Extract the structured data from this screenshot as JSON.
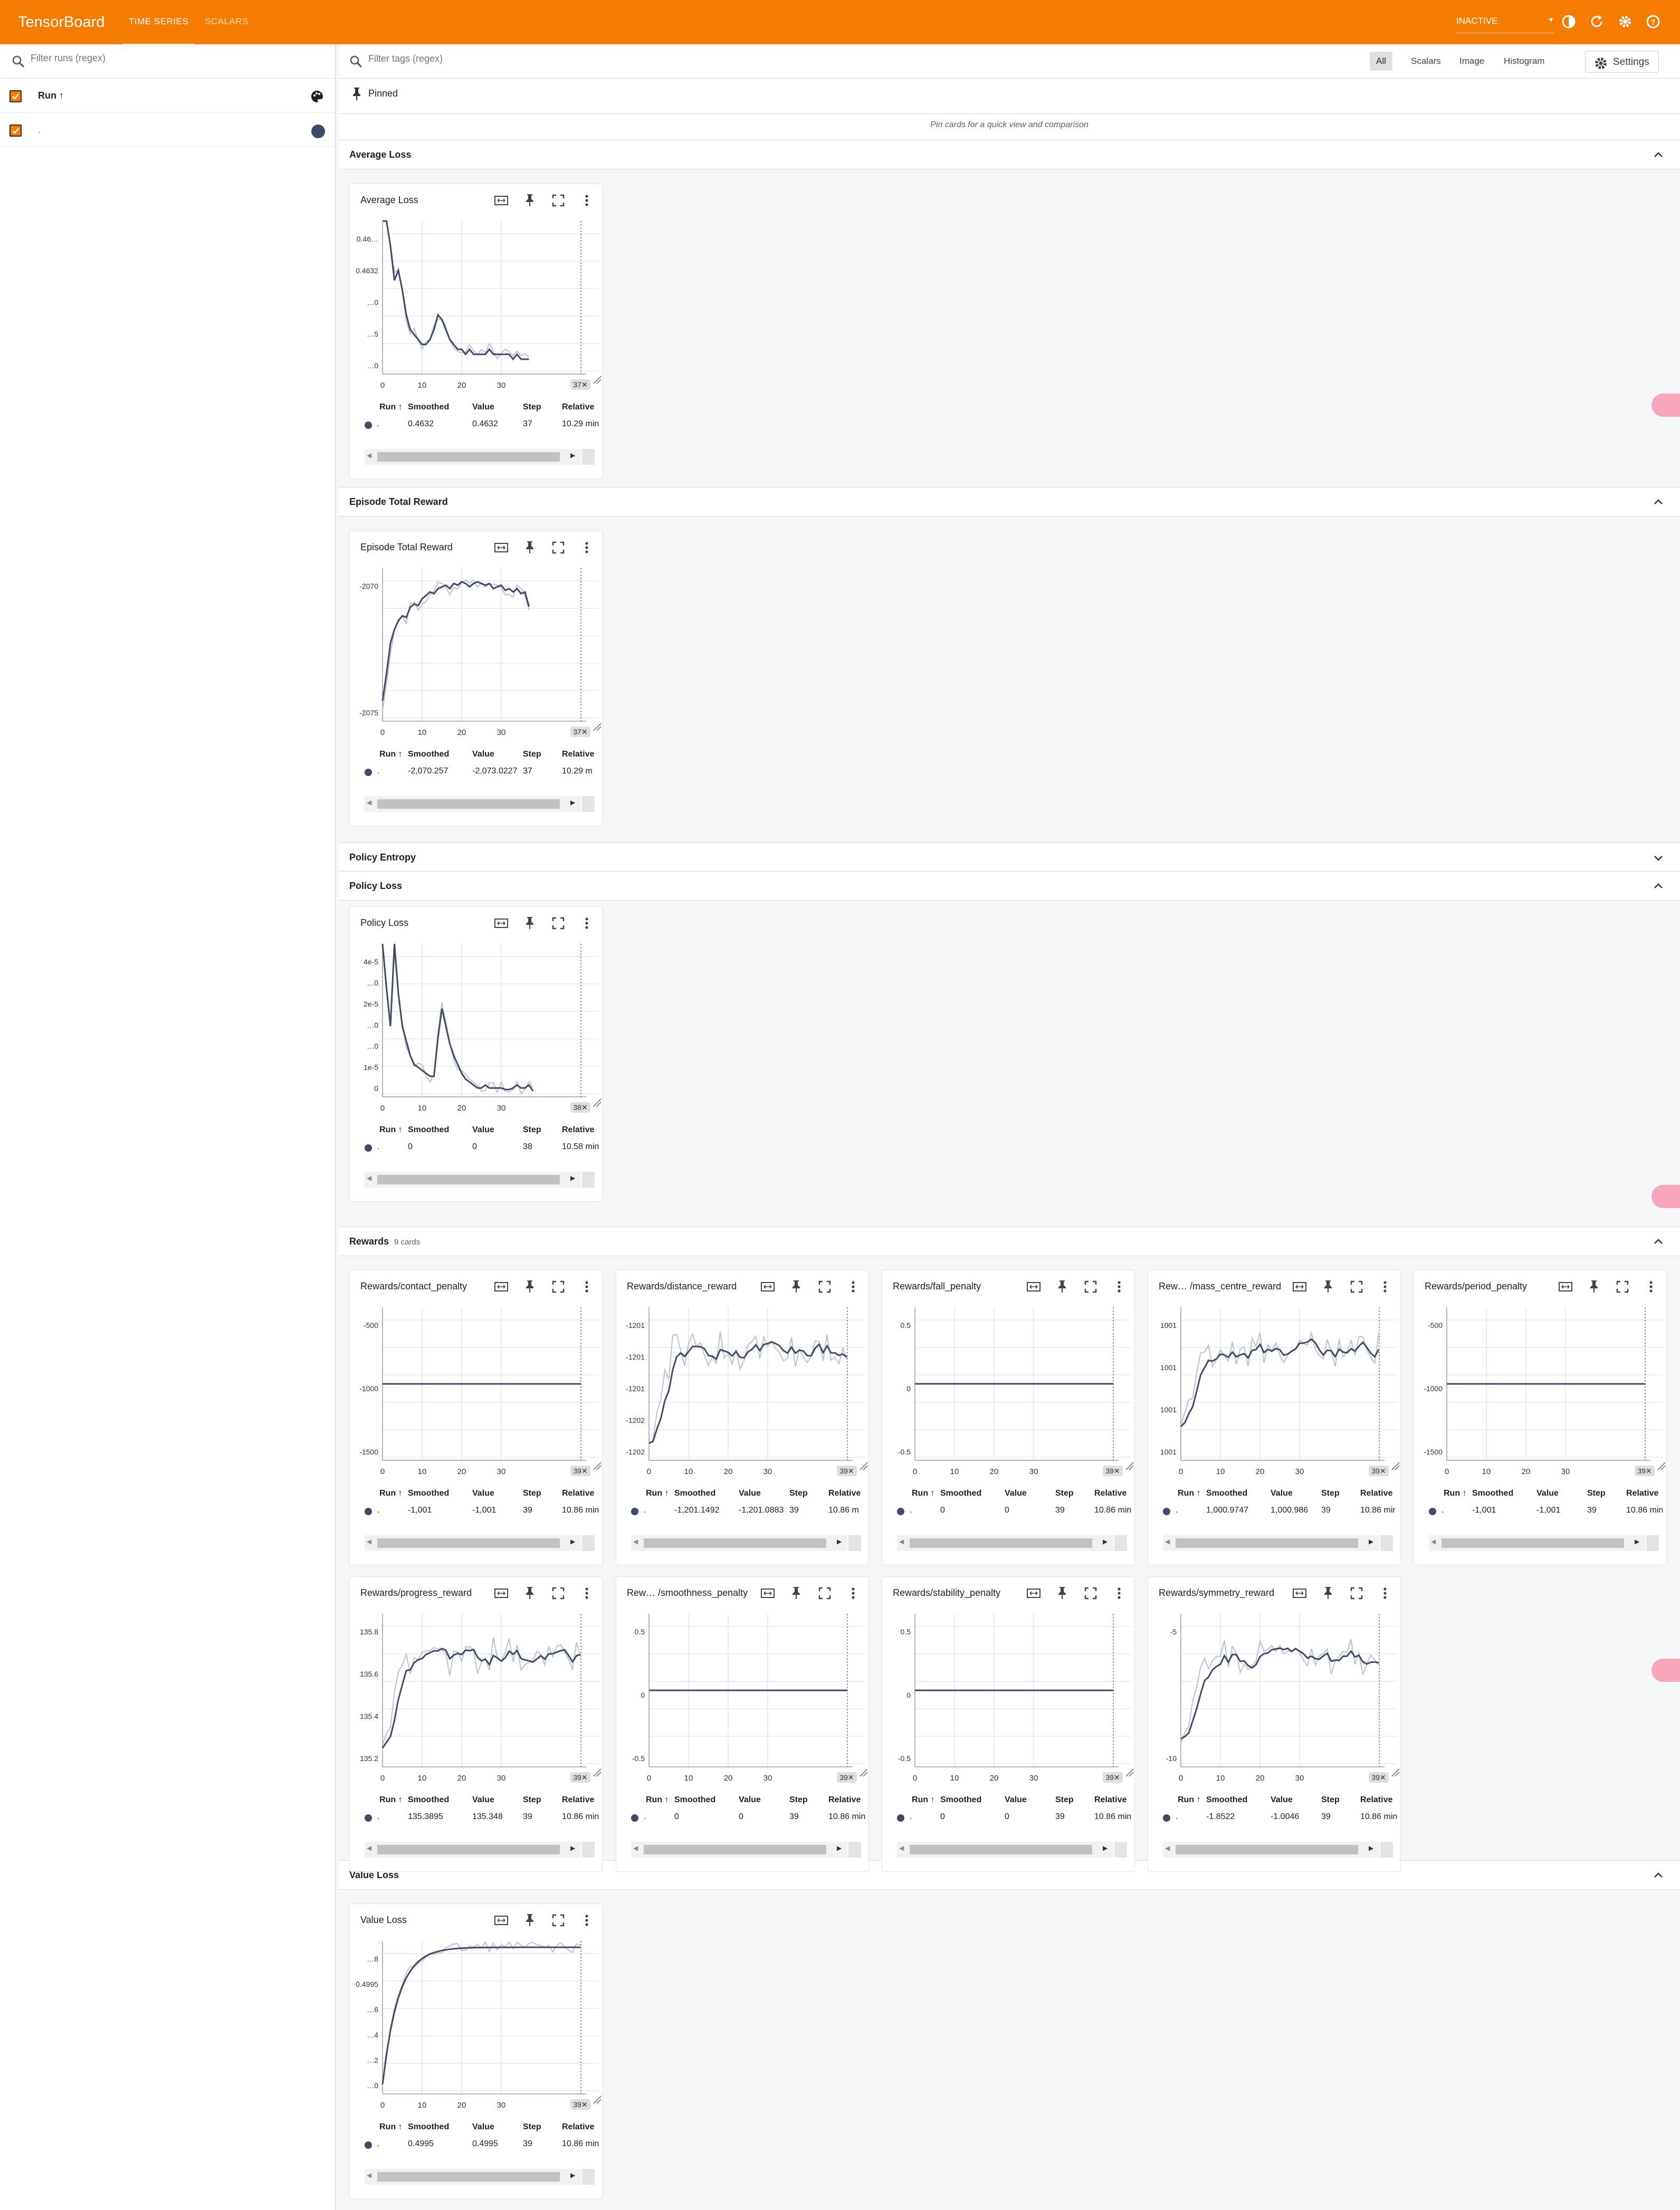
{
  "app": {
    "brand": "TensorBoard",
    "tabs": [
      "TIME SERIES",
      "SCALARS"
    ],
    "status": "INACTIVE",
    "accent": "#f57c00"
  },
  "runs_panel": {
    "filter_placeholder": "Filter runs (regex)",
    "header_label": "Run ↑",
    "runs": [
      {
        "label": ".",
        "color": "#3f4b66"
      }
    ]
  },
  "tag_filter": {
    "placeholder": "Filter tags (regex)",
    "types": [
      "All",
      "Scalars",
      "Image",
      "Histogram"
    ],
    "settings_label": "Settings"
  },
  "pinned": {
    "title": "Pinned",
    "hint": "Pin cards for a quick view and comparison"
  },
  "table_headers": [
    "Run ↑",
    "Smoothed",
    "Value",
    "Step",
    "Relative"
  ],
  "groups": [
    {
      "title": "Average Loss",
      "count_label": "",
      "expanded": true
    },
    {
      "title": "Episode Total Reward",
      "count_label": "",
      "expanded": true
    },
    {
      "title": "Policy Entropy",
      "count_label": "",
      "expanded": false
    },
    {
      "title": "Policy Loss",
      "count_label": "",
      "expanded": true
    },
    {
      "title": "Rewards",
      "count_label": "9 cards",
      "expanded": true
    },
    {
      "title": "Value Loss",
      "count_label": "",
      "expanded": true
    }
  ],
  "cards": [
    {
      "title": "Average Loss",
      "last_step_label": "37",
      "row": {
        "run": ".",
        "smoothed": "0.4632",
        "value": "0.4632",
        "step": "37",
        "relative": "10.29 min"
      },
      "chart_data": {
        "type": "line",
        "x": [
          0,
          1,
          2,
          3,
          4,
          5,
          6,
          7,
          8,
          9,
          10,
          11,
          12,
          13,
          14,
          15,
          16,
          17,
          18,
          19,
          20,
          21,
          22,
          23,
          24,
          25,
          26,
          27,
          28,
          29,
          30,
          31,
          32,
          33,
          34,
          35,
          36,
          37
        ],
        "series": [
          {
            "values": [
              0.4675,
              0.4668,
              0.4655,
              0.4648,
              0.465,
              0.4646,
              0.4641,
              0.4638,
              0.4637,
              0.4636,
              0.4635,
              0.4635,
              0.4636,
              0.4638,
              0.4641,
              0.464,
              0.4638,
              0.4636,
              0.4635,
              0.4634,
              0.4634,
              0.4633,
              0.4634,
              0.4633,
              0.4633,
              0.4633,
              0.4633,
              0.4634,
              0.4633,
              0.4633,
              0.4633,
              0.4633,
              0.4633,
              0.4632,
              0.4633,
              0.4632,
              0.4632,
              0.4632
            ]
          }
        ],
        "yticks": [
          "0.463",
          "0.4632",
          "0.465",
          "0.4633",
          "0.464"
        ],
        "ytick_labels": [
          "0.46…",
          "0.4632",
          "…0",
          "…5",
          "…0"
        ],
        "xticks": [
          0,
          10,
          20,
          30
        ],
        "ylim": [
          0.4629,
          0.466
        ]
      }
    },
    {
      "title": "Episode Total Reward",
      "last_step_label": "37",
      "row": {
        "run": ".",
        "smoothed": "-2,070.257",
        "value": "-2,073.0227",
        "step": "37",
        "relative": "10.29 m"
      },
      "chart_data": {
        "type": "line",
        "x": [
          0,
          1,
          2,
          3,
          4,
          5,
          6,
          7,
          8,
          9,
          10,
          11,
          12,
          13,
          14,
          15,
          16,
          17,
          18,
          19,
          20,
          21,
          22,
          23,
          24,
          25,
          26,
          27,
          28,
          29,
          30,
          31,
          32,
          33,
          34,
          35,
          36,
          37
        ],
        "series": [
          {
            "values": [
              -2075.8,
              -2074.2,
              -2072.4,
              -2071.6,
              -2071.1,
              -2070.8,
              -2070.9,
              -2070.3,
              -2070.1,
              -2070.2,
              -2069.8,
              -2069.6,
              -2069.4,
              -2069.5,
              -2069.2,
              -2069.1,
              -2069.0,
              -2069.2,
              -2068.9,
              -2069.0,
              -2068.8,
              -2068.9,
              -2069.1,
              -2068.9,
              -2068.8,
              -2068.9,
              -2069.0,
              -2068.9,
              -2069.2,
              -2069.1,
              -2069.0,
              -2069.3,
              -2069.2,
              -2069.4,
              -2069.2,
              -2069.5,
              -2069.4,
              -2070.26
            ]
          }
        ],
        "yticks": [
          -2070,
          -2075
        ],
        "xticks": [
          0,
          10,
          20,
          30
        ],
        "ylim": [
          -2077,
          -2068
        ]
      }
    },
    {
      "title": "Policy Loss",
      "last_step_label": "38",
      "row": {
        "run": ".",
        "smoothed": "0",
        "value": "0",
        "step": "38",
        "relative": "10.58 min"
      },
      "chart_data": {
        "type": "line",
        "x": [
          0,
          1,
          2,
          3,
          4,
          5,
          6,
          7,
          8,
          9,
          10,
          11,
          12,
          13,
          14,
          15,
          16,
          17,
          18,
          19,
          20,
          21,
          22,
          23,
          24,
          25,
          26,
          27,
          28,
          29,
          30,
          31,
          32,
          33,
          34,
          35,
          36,
          37,
          38
        ],
        "series": [
          {
            "values": [
              5e-05,
              3.5e-05,
              2.2e-05,
              5e-05,
              3.3e-05,
              2.2e-05,
              1.7e-05,
              1.2e-05,
              9e-06,
              8e-06,
              7e-06,
              6e-06,
              5e-06,
              5e-06,
              1.8e-05,
              2.8e-05,
              2.2e-05,
              1.6e-05,
              1.2e-05,
              9e-06,
              6e-06,
              4e-06,
              3e-06,
              2e-06,
              1e-06,
              1e-06,
              2e-06,
              1e-06,
              1e-06,
              1e-06,
              1e-06,
              5e-07,
              5e-07,
              1e-06,
              2e-06,
              1e-06,
              1e-06,
              2e-06,
              0
            ]
          }
        ],
        "ytick_labels": [
          "4e-5",
          "…0",
          "2e-5",
          "…0",
          "…0",
          "1e-5",
          "0"
        ],
        "xticks": [
          0,
          10,
          20,
          30
        ],
        "ylim": [
          -2e-06,
          5e-05
        ]
      }
    },
    {
      "title": "Rewards/contact_penalty",
      "last_step_label": "39",
      "row": {
        "run": ".",
        "smoothed": "-1,001",
        "value": "-1,001",
        "step": "39",
        "relative": "10.86 min"
      },
      "chart_data": {
        "type": "line",
        "flat": -1001,
        "yticks": [
          -500,
          -1000,
          -1500
        ],
        "xticks": [
          0,
          10,
          20,
          30
        ],
        "ylim": [
          -2000,
          0
        ]
      }
    },
    {
      "title": "Rewards/distance_reward",
      "last_step_label": "39",
      "row": {
        "run": ".",
        "smoothed": "-1,201.1492",
        "value": "-1,201.0883",
        "step": "39",
        "relative": "10.86 m"
      },
      "chart_data": {
        "type": "line",
        "ytick_labels": [
          "-1201",
          "-1201",
          "-1201",
          "-1202",
          "-1202"
        ],
        "xticks": [
          0,
          10,
          20,
          30
        ],
        "noisy": true
      }
    },
    {
      "title": "Rewards/fall_penalty",
      "last_step_label": "39",
      "row": {
        "run": ".",
        "smoothed": "0",
        "value": "0",
        "step": "39",
        "relative": "10.86 min"
      },
      "chart_data": {
        "type": "line",
        "flat": 0,
        "yticks": [
          0.5,
          0,
          -0.5
        ],
        "xticks": [
          0,
          10,
          20,
          30
        ],
        "ylim": [
          -1,
          1
        ]
      }
    },
    {
      "title": "Rew… /mass_centre_reward",
      "last_step_label": "39",
      "row": {
        "run": ".",
        "smoothed": "1,000.9747",
        "value": "1,000.986",
        "step": "39",
        "relative": "10.86 mir"
      },
      "chart_data": {
        "type": "line",
        "ytick_labels": [
          "1001",
          "1001",
          "1001",
          "1001"
        ],
        "xticks": [
          0,
          10,
          20,
          30
        ],
        "noisy": true
      }
    },
    {
      "title": "Rewards/period_penalty",
      "last_step_label": "39",
      "row": {
        "run": ".",
        "smoothed": "-1,001",
        "value": "-1,001",
        "step": "39",
        "relative": "10.86 min"
      },
      "chart_data": {
        "type": "line",
        "flat": -1001,
        "yticks": [
          -500,
          -1000,
          -1500
        ],
        "xticks": [
          0,
          10,
          20,
          30
        ],
        "ylim": [
          -2000,
          0
        ]
      }
    },
    {
      "title": "Rewards/progress_reward",
      "last_step_label": "39",
      "row": {
        "run": ".",
        "smoothed": "135.3895",
        "value": "135.348",
        "step": "39",
        "relative": "10.86 min"
      },
      "chart_data": {
        "type": "line",
        "yticks": [
          "135.8",
          "135.6",
          "135.4",
          "135.2"
        ],
        "xticks": [
          0,
          10,
          20,
          30
        ],
        "noisy": true
      }
    },
    {
      "title": "Rew… /smoothness_penalty",
      "last_step_label": "39",
      "row": {
        "run": ".",
        "smoothed": "0",
        "value": "0",
        "step": "39",
        "relative": "10.86 min"
      },
      "chart_data": {
        "type": "line",
        "flat": 0,
        "yticks": [
          0.5,
          0,
          -0.5
        ],
        "xticks": [
          0,
          10,
          20,
          30
        ],
        "ylim": [
          -1,
          1
        ]
      }
    },
    {
      "title": "Rewards/stability_penalty",
      "last_step_label": "39",
      "row": {
        "run": ".",
        "smoothed": "0",
        "value": "0",
        "step": "39",
        "relative": "10.86 min"
      },
      "chart_data": {
        "type": "line",
        "flat": 0,
        "yticks": [
          0.5,
          0,
          -0.5
        ],
        "xticks": [
          0,
          10,
          20,
          30
        ],
        "ylim": [
          -1,
          1
        ]
      }
    },
    {
      "title": "Rewards/symmetry_reward",
      "last_step_label": "39",
      "row": {
        "run": ".",
        "smoothed": "-1.8522",
        "value": "-1.0046",
        "step": "39",
        "relative": "10.86 min"
      },
      "chart_data": {
        "type": "line",
        "yticks": [
          -5,
          -10
        ],
        "xticks": [
          0,
          10,
          20,
          30
        ],
        "noisy": true
      }
    },
    {
      "title": "Value Loss",
      "last_step_label": "39",
      "row": {
        "run": ".",
        "smoothed": "0.4995",
        "value": "0.4995",
        "step": "39",
        "relative": "10.86 min"
      },
      "chart_data": {
        "type": "line",
        "ytick_labels": [
          "…8",
          "0.4995",
          "…6",
          "…4",
          "…2",
          "…0"
        ],
        "xticks": [
          0,
          10,
          20,
          30
        ]
      }
    }
  ]
}
